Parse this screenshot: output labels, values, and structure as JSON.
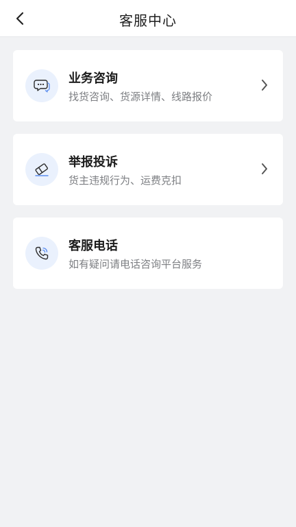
{
  "header": {
    "title": "客服中心",
    "back_icon": "chevron-left-icon"
  },
  "items": [
    {
      "title": "业务咨询",
      "description": "找货咨询、货源详情、线路报价",
      "icon": "chat-bubbles-icon",
      "has_chevron": true
    },
    {
      "title": "举报投诉",
      "description": "货主违规行为、运费克扣",
      "icon": "eraser-icon",
      "has_chevron": true
    },
    {
      "title": "客服电话",
      "description": "如有疑问请电话咨询平台服务",
      "icon": "phone-icon",
      "has_chevron": false
    }
  ],
  "colors": {
    "background": "#f1f2f4",
    "card": "#ffffff",
    "icon_bg": "#eaf1fd",
    "title": "#1c1c1c",
    "description": "#7d7f83"
  }
}
